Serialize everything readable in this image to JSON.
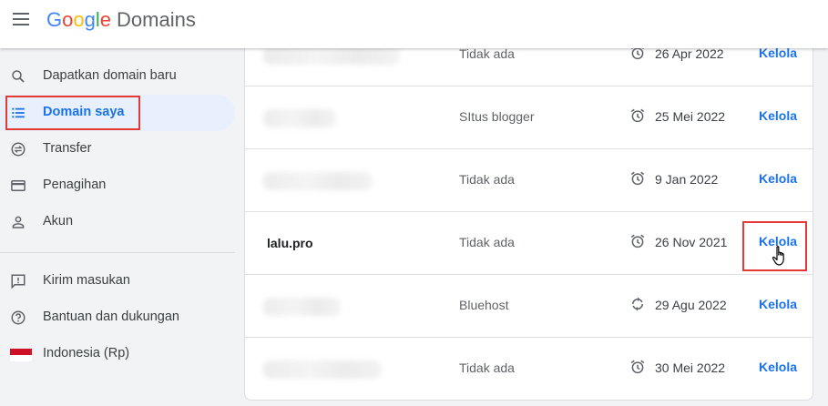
{
  "header": {
    "logo": {
      "G": "G",
      "o1": "o",
      "o2": "o",
      "g": "g",
      "l": "l",
      "e": "e",
      "product": "Domains"
    }
  },
  "sidebar": {
    "items": [
      {
        "label": "Dapatkan domain baru",
        "icon": "search-icon"
      },
      {
        "label": "Domain saya",
        "icon": "list-icon",
        "active": true
      },
      {
        "label": "Transfer",
        "icon": "transfer-icon"
      },
      {
        "label": "Penagihan",
        "icon": "credit-card-icon"
      },
      {
        "label": "Akun",
        "icon": "person-icon"
      }
    ],
    "footer_items": [
      {
        "label": "Kirim masukan",
        "icon": "feedback-icon"
      },
      {
        "label": "Bantuan dan dukungan",
        "icon": "help-icon"
      },
      {
        "label": "Indonesia (Rp)",
        "icon": "indonesia-flag-icon"
      }
    ]
  },
  "table": {
    "rows": [
      {
        "domain": "",
        "site": "Tidak ada",
        "date": "26 Apr 2022",
        "date_icon": "alarm-icon",
        "action": "Kelola"
      },
      {
        "domain": "",
        "site": "SItus blogger",
        "date": "25 Mei 2022",
        "date_icon": "alarm-icon",
        "action": "Kelola"
      },
      {
        "domain": "",
        "site": "Tidak ada",
        "date": "9 Jan 2022",
        "date_icon": "alarm-icon",
        "action": "Kelola"
      },
      {
        "domain": "lalu.pro",
        "site": "Tidak ada",
        "date": "26 Nov 2021",
        "date_icon": "alarm-icon",
        "action": "Kelola"
      },
      {
        "domain": "",
        "site": "Bluehost",
        "date": "29 Agu 2022",
        "date_icon": "autorenew-icon",
        "action": "Kelola"
      },
      {
        "domain": "",
        "site": "Tidak ada",
        "date": "30 Mei 2022",
        "date_icon": "alarm-icon",
        "action": "Kelola"
      }
    ]
  },
  "colors": {
    "accent": "#1a73e8",
    "highlight": "#e53935",
    "active_bg": "#e8f0fe"
  }
}
